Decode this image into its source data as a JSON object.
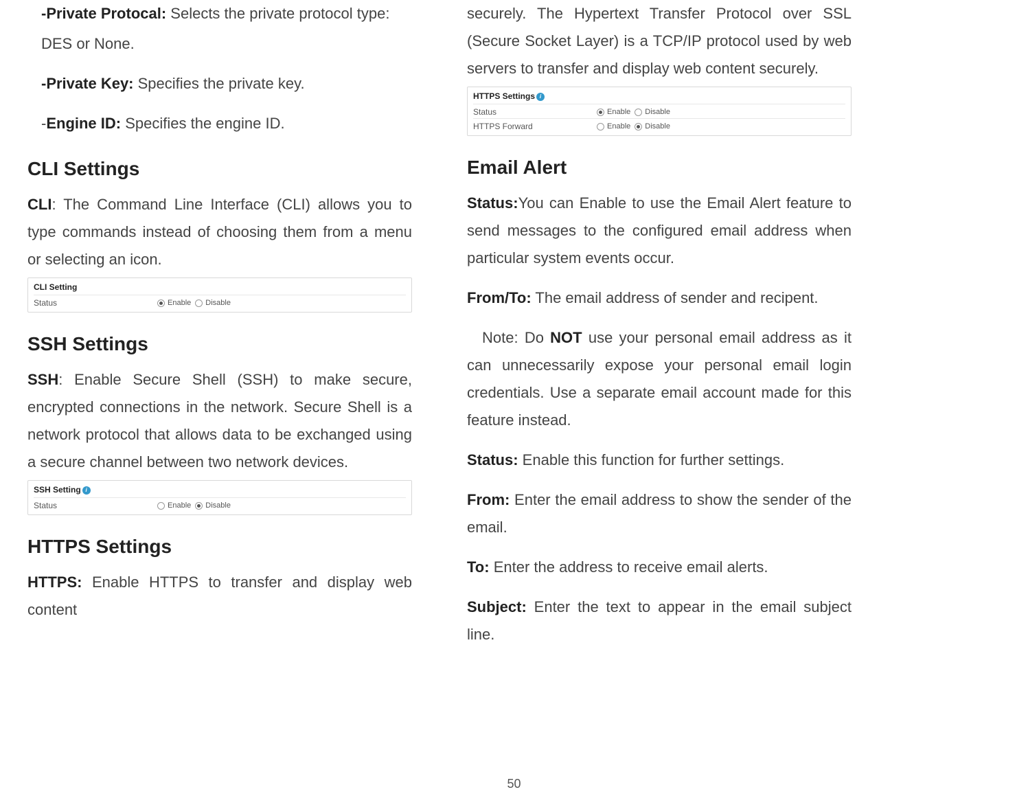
{
  "left": {
    "items": [
      {
        "label": "-Private Protocal:",
        "text": " Selects the private protocol type:"
      },
      {
        "label": "",
        "text": " DES or None."
      },
      {
        "label": "-Private Key:",
        "text": " Specifies the private key."
      },
      {
        "label": "-Engine ID:",
        "text": " Specifies the engine ID."
      }
    ],
    "cli": {
      "heading": "CLI Settings",
      "lead_bold": "CLI",
      "lead_text": ": The Command Line Interface (CLI) allows you to type commands instead of choosing them from a menu or selecting an icon.",
      "panel": {
        "title": "CLI Setting",
        "rows": [
          {
            "label": "Status",
            "opts": [
              {
                "label": "Enable",
                "checked": true
              },
              {
                "label": "Disable",
                "checked": false
              }
            ]
          }
        ]
      }
    },
    "ssh": {
      "heading": "SSH Settings",
      "lead_bold": "SSH",
      "lead_text": ": Enable Secure Shell (SSH) to make secure, encrypted connections in the network. Secure Shell is a network protocol that allows data to be exchanged using a secure channel between two network devices.",
      "panel": {
        "title": "SSH Setting",
        "rows": [
          {
            "label": "Status",
            "opts": [
              {
                "label": "Enable",
                "checked": false
              },
              {
                "label": "Disable",
                "checked": true
              }
            ]
          }
        ]
      }
    },
    "https": {
      "heading_prefix": "HTTPS",
      "heading_rest": " Settings",
      "lead_bold": "HTTPS:",
      "lead_text": " Enable HTTPS to transfer and display web content"
    }
  },
  "right": {
    "top_para": "securely. The Hypertext Transfer Protocol over SSL (Secure Socket Layer) is a TCP/IP protocol used by web servers to transfer and display web content securely.",
    "https_panel": {
      "title": "HTTPS Settings",
      "rows": [
        {
          "label": "Status",
          "opts": [
            {
              "label": "Enable",
              "checked": true
            },
            {
              "label": "Disable",
              "checked": false
            }
          ]
        },
        {
          "label": "HTTPS Forward",
          "opts": [
            {
              "label": "Enable",
              "checked": false
            },
            {
              "label": "Disable",
              "checked": true
            }
          ]
        }
      ]
    },
    "email": {
      "heading": "Email Alert",
      "paras": [
        {
          "label": "Status:",
          "text": "You can Enable to use the Email Alert feature to send messages to the configured email address when particular system events occur."
        },
        {
          "label": "From/To:",
          "text": " The email address of sender and recipent."
        }
      ],
      "note_pre": "   Note: Do ",
      "note_bold": "NOT",
      "note_post": " use your personal email address as it can unnecessarily expose your personal email login credentials. Use a separate email account made for this feature instead.",
      "tail": [
        {
          "label": "Status:",
          "text": " Enable this function for further settings."
        },
        {
          "label": "From:",
          "text": " Enter the email address to show the sender of the email."
        },
        {
          "label": "To:",
          "text": " Enter the address to receive email alerts."
        },
        {
          "label": "Subject:",
          "text": " Enter the text to appear in the email subject line."
        }
      ]
    }
  },
  "page_number": "50"
}
